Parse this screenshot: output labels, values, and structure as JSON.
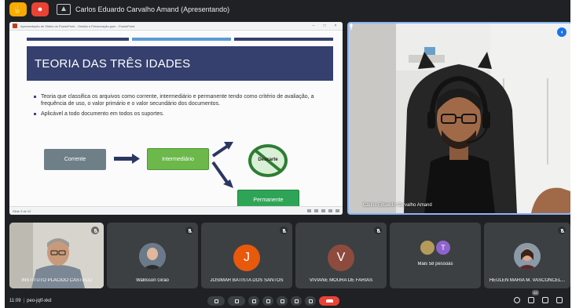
{
  "top_bar": {
    "presenter_text": "Carlos Eduardo Carvalho Amand (Apresentando)",
    "icons": [
      "hand-icon",
      "record-icon",
      "present-screen-icon"
    ]
  },
  "slide_window": {
    "window_title": "Apresentação de Slides do PowerPoint - Gestão e Preservação.pptx - PowerPoint",
    "status_text": "Slide 3 de 12"
  },
  "slide": {
    "title": "TEORIA DAS TRÊS IDADES",
    "bullets": [
      "Teoria que classifica os arquivos como corrente, intermediário e permanente tendo como critério de avaliação, a frequência de uso, o valor primário e o valor secundário dos documentos.",
      "Aplicável a todo documento em todos os suportes."
    ],
    "flow": {
      "corrente": "Corrente",
      "intermediario": "Intermediário",
      "permanente": "Permanente",
      "descarte": "Descarte"
    },
    "colors": {
      "title_bar": "#35406e",
      "corrente": "#6f7f88",
      "intermediario": "#6cb84a",
      "permanente": "#2ea556",
      "descarte_ring": "#2e7d32"
    }
  },
  "main_speaker": {
    "name": "Carlos Eduardo Carvalho Amand"
  },
  "participants": [
    {
      "name": "INSTITUTO PLACIDO CASTELO",
      "type": "video"
    },
    {
      "name": "Wallisson Girão",
      "type": "photo"
    },
    {
      "name": "JOSIMAR BATISTA DOS SANTOS",
      "type": "initial",
      "initial": "J",
      "color": "#e8590c"
    },
    {
      "name": "VIVIANE MOURA DE FARIAS",
      "type": "initial",
      "initial": "V",
      "color": "#8d4b3e"
    },
    {
      "name": "Mais 58 pessoas",
      "type": "group",
      "initial": "T",
      "color": "#8e63ce"
    },
    {
      "name": "HEULEN MARIA M. VASCONCEL...",
      "type": "photo"
    }
  ],
  "toolbar": {
    "time": "11:09",
    "separator": "|",
    "meeting_code": "peo-jqtf-xkd",
    "people_count": "63"
  }
}
